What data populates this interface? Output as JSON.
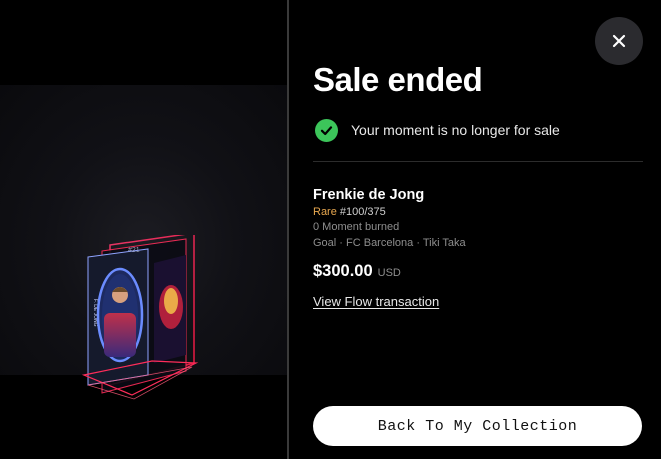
{
  "media": {
    "card_number": "#21",
    "card_side_text": "F. DE JONG"
  },
  "close_button": {
    "icon": "close-icon"
  },
  "sale": {
    "title": "Sale ended",
    "status_icon": "check-circle-icon",
    "status_color": "#3cc55a",
    "status_text": "Your moment is no longer for sale"
  },
  "moment": {
    "player_name": "Frenkie de Jong",
    "rarity": "Rare",
    "rarity_color": "#e8a850",
    "serial": "#100/375",
    "burned": "0 Moment burned",
    "meta": "Goal · FC Barcelona · Tiki Taka",
    "price": "$300.00",
    "currency": "USD",
    "flow_link": "View Flow transaction"
  },
  "actions": {
    "back_label": "Back To My Collection"
  }
}
